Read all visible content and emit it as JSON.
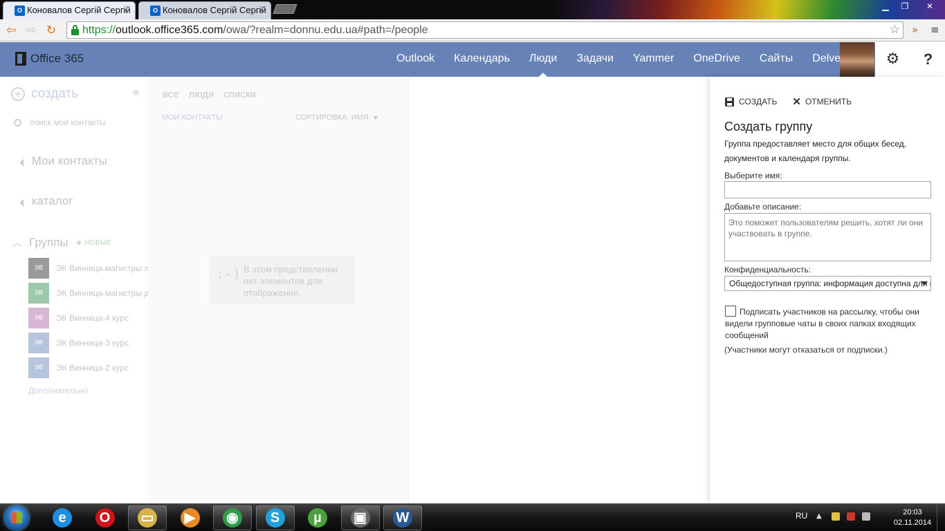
{
  "browser": {
    "tabs": [
      {
        "title": "Коновалов Сергій Сергій"
      },
      {
        "title": "Коновалов Сергій Сергій"
      }
    ],
    "favicon_label": "O",
    "close_glyph": "×",
    "url": {
      "scheme": "https://",
      "host": "outlook.office365.com",
      "path": "/owa/?realm=donnu.edu.ua#path=/people"
    }
  },
  "o365": {
    "brand": "Office 365",
    "nav": [
      "Outlook",
      "Календарь",
      "Люди",
      "Задачи",
      "Yammer",
      "OneDrive",
      "Сайты",
      "Delve"
    ],
    "active_nav": "Люди",
    "gear_glyph": "⚙",
    "help_glyph": "?"
  },
  "left": {
    "new_label": "создать",
    "plus_glyph": "+",
    "collapse_glyph": "«",
    "search_placeholder": "поиск мои контакты",
    "my_contacts": "Мои контакты",
    "directory": "каталог",
    "groups_title": "Группы",
    "groups_new_badge": "НОВЫЕ",
    "groups": [
      {
        "initials": "ЭВ",
        "name": "ЭК Винница-магистры за",
        "color": "#9a9a9a"
      },
      {
        "initials": "ЭВ",
        "name": "ЭК Винница-магистры д",
        "color": "#9ec9a8"
      },
      {
        "initials": "ЭВ",
        "name": "ЭК Винница-4 курс",
        "color": "#d7b6d3"
      },
      {
        "initials": "ЭВ",
        "name": "ЭК Винница-3 курс",
        "color": "#b7c4dd"
      },
      {
        "initials": "ЭВ",
        "name": "ЭК Винница-2 курс",
        "color": "#b7c4dd"
      }
    ],
    "more_link": "Дополнительно"
  },
  "middle": {
    "pivots": [
      "все",
      "люди",
      "списки"
    ],
    "list_header": "МОИ КОНТАКТЫ",
    "sort_label": "СОРТИРОВКА: ИМЯ",
    "empty_face": ":-)",
    "empty_message": "В этом представлении нет элементов для отображения."
  },
  "panel": {
    "save_label": "СОЗДАТЬ",
    "cancel_label": "ОТМЕНИТЬ",
    "cancel_glyph": "✕",
    "title": "Создать группу",
    "description": "Группа предоставляет место для общих бесед, документов и календаря группы.",
    "name_label": "Выберите имя:",
    "name_value": "",
    "desc_label": "Добавьте описание:",
    "desc_placeholder": "Это поможет пользователям решить, хотят ли они участвовать в группе.",
    "privacy_label": "Конфиденциальность:",
    "privacy_value": "Общедоступная группа: информация доступна для всех",
    "subscribe_label": "Подписать участников на рассылку, чтобы они видели групповые чаты в своих папках входящих сообщений",
    "subscribe_checked": false,
    "note": "(Участники могут отказаться от подписки.)"
  },
  "taskbar": {
    "apps": [
      {
        "name": "ie-icon",
        "glyph": "e",
        "color": "#1e8fe0"
      },
      {
        "name": "opera-icon",
        "glyph": "O",
        "color": "#d0141c"
      },
      {
        "name": "explorer-icon",
        "glyph": "▭",
        "color": "#d8b24a"
      },
      {
        "name": "media-player-icon",
        "glyph": "▶",
        "color": "#e88a2a"
      },
      {
        "name": "chrome-icon",
        "glyph": "◉",
        "color": "#2e9e4a"
      },
      {
        "name": "skype-icon",
        "glyph": "S",
        "color": "#1fa2e0"
      },
      {
        "name": "utorrent-icon",
        "glyph": "µ",
        "color": "#4aa03a"
      },
      {
        "name": "network-monitor-icon",
        "glyph": "▣",
        "color": "#6a6a6a"
      },
      {
        "name": "word-icon",
        "glyph": "W",
        "color": "#2b5797"
      }
    ],
    "language": "RU",
    "time": "20:03",
    "date": "02.11.2014"
  }
}
